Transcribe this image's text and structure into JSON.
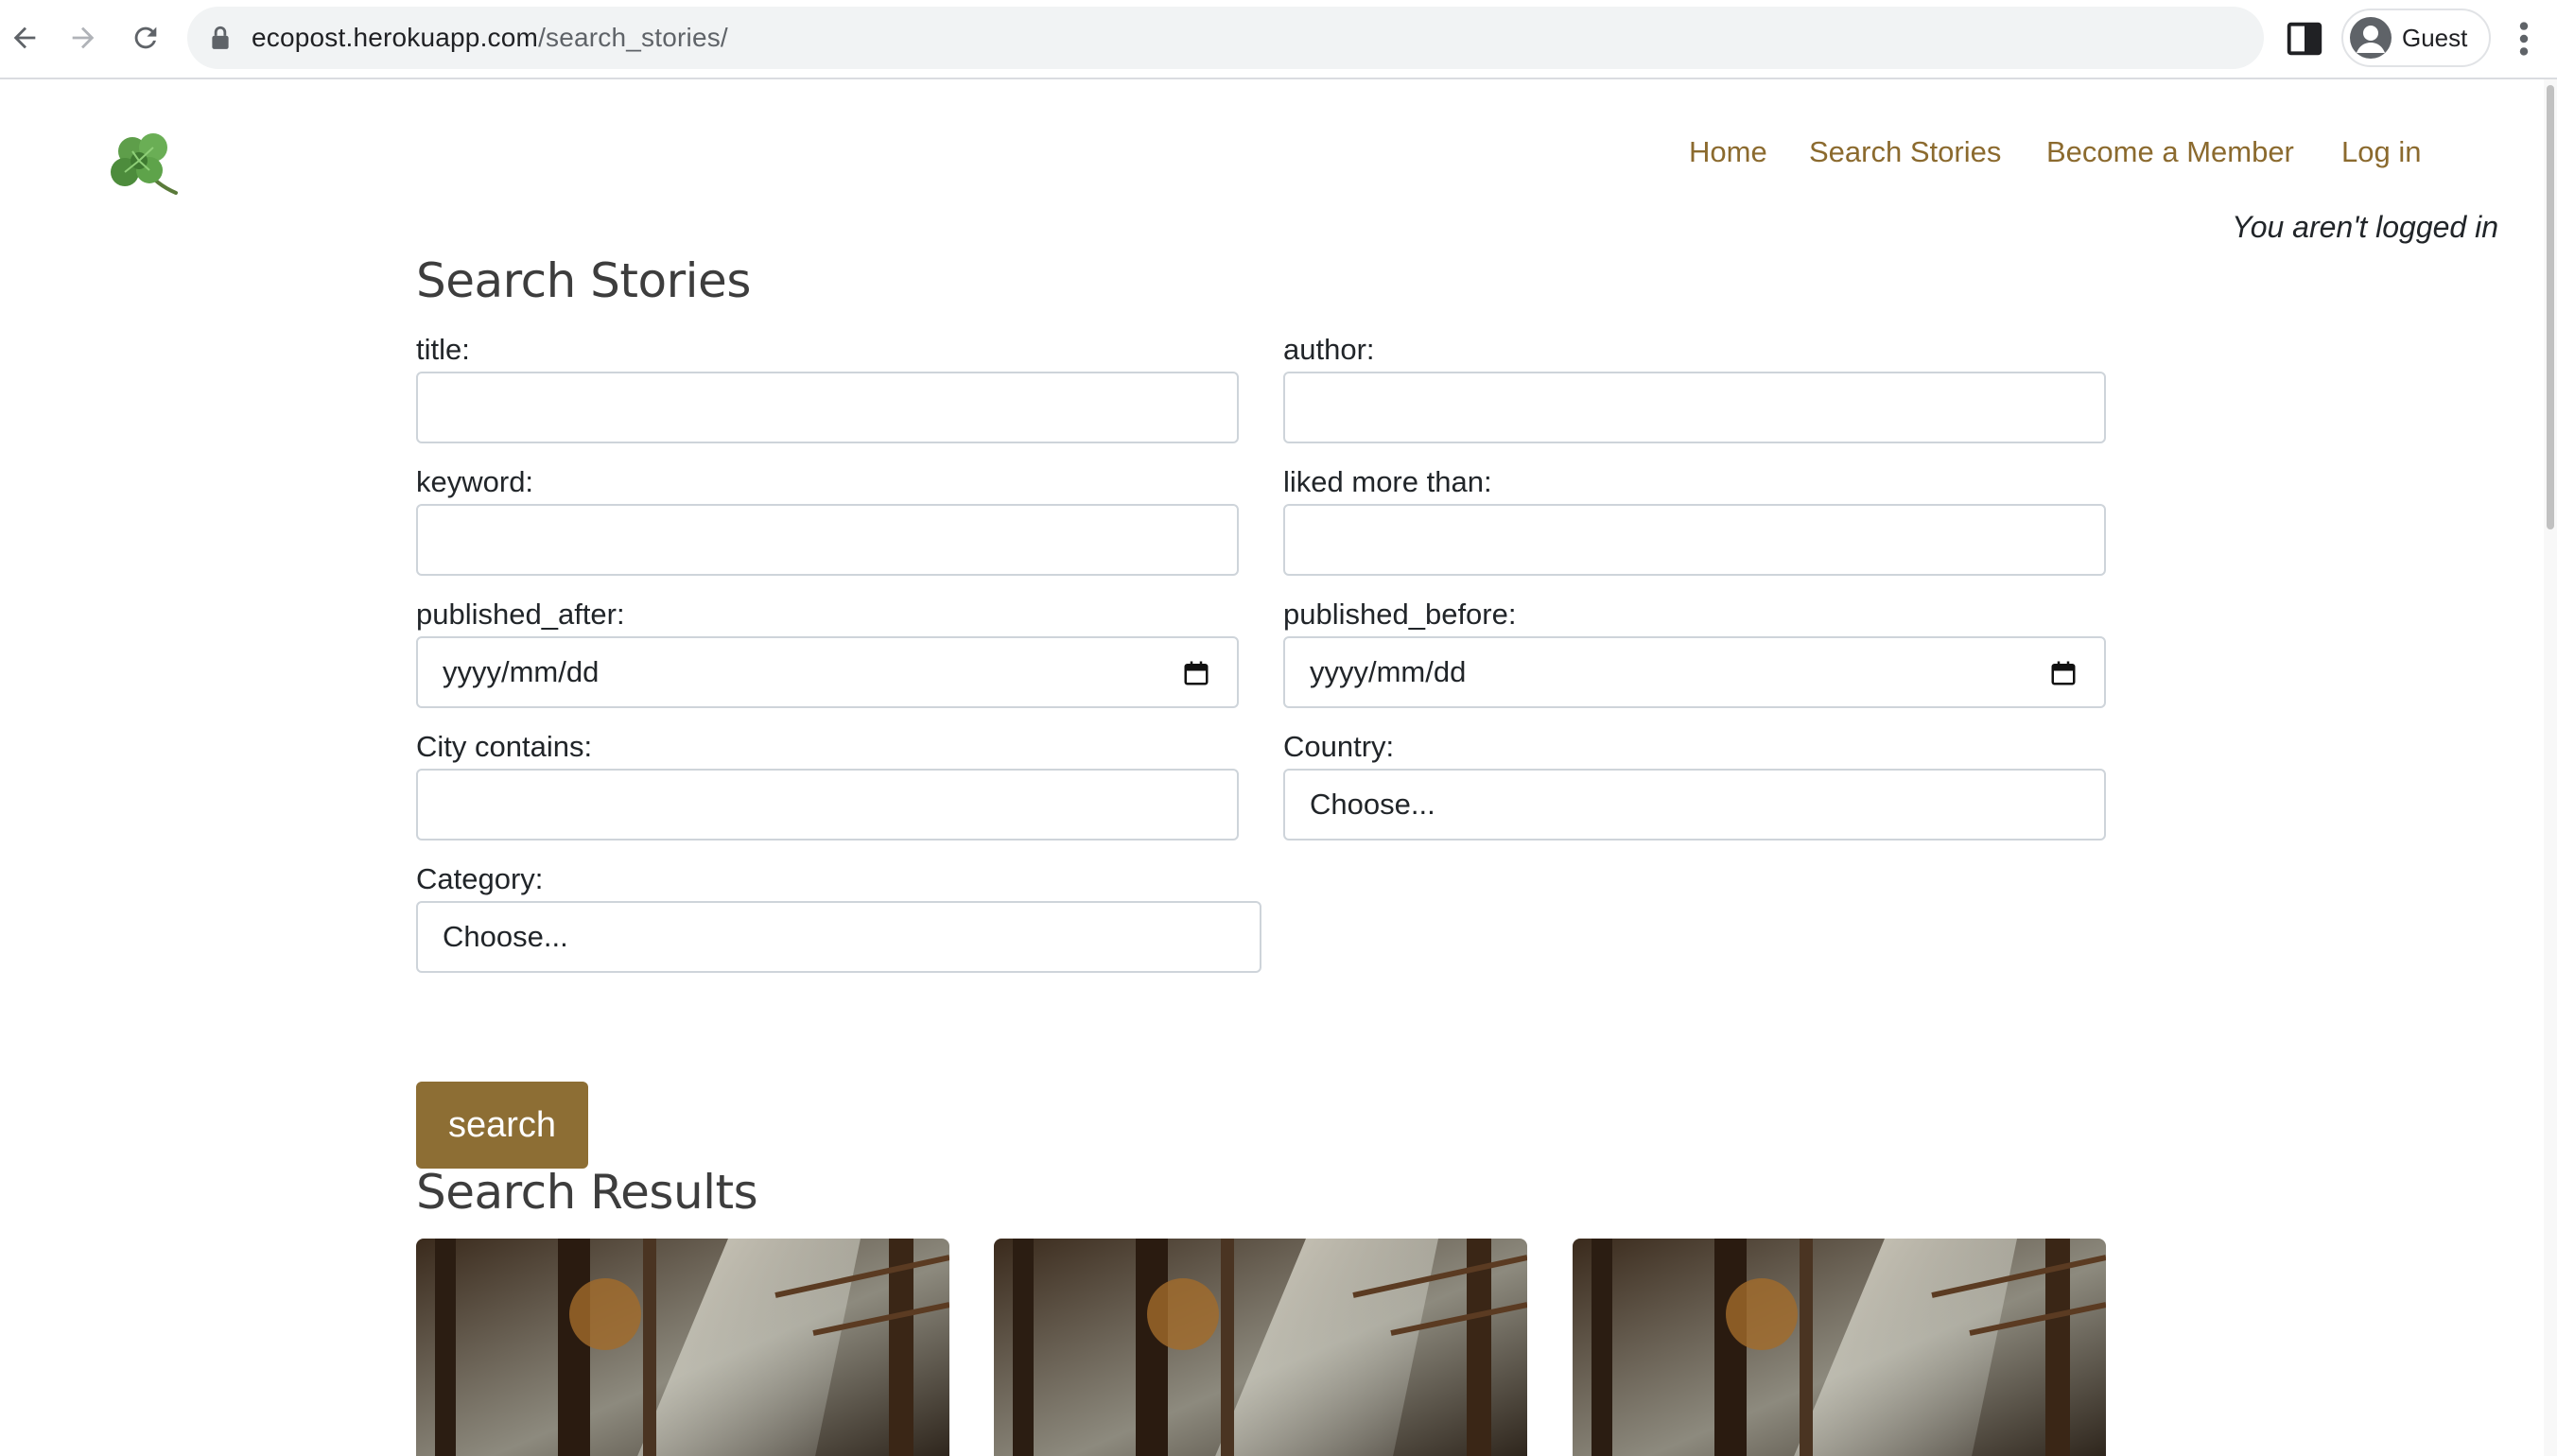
{
  "browser": {
    "url_host": "ecopost.herokuapp.com",
    "url_path": "/search_stories/",
    "profile_name": "Guest"
  },
  "nav": {
    "home": "Home",
    "search_stories": "Search Stories",
    "become_member": "Become a Member",
    "login": "Log in"
  },
  "status": {
    "login_text": "You aren't logged in"
  },
  "search_form": {
    "title": "Search Stories",
    "title_label": "title:",
    "author_label": "author:",
    "keyword_label": "keyword:",
    "liked_label": "liked more than:",
    "published_after_label": "published_after:",
    "published_after_value": "yyyy/mm/dd",
    "published_before_label": "published_before:",
    "published_before_value": "yyyy/mm/dd",
    "city_label": "City contains:",
    "country_label": "Country:",
    "country_value": "Choose...",
    "category_label": "Category:",
    "category_value": "Choose...",
    "submit_label": "search"
  },
  "results": {
    "title": "Search Results",
    "card_count": 3
  },
  "colors": {
    "accent": "#8d6e34",
    "nav_link": "#8b6a2e",
    "input_border": "#ced4da"
  },
  "icons": [
    "back-arrow-icon",
    "forward-arrow-icon",
    "reload-icon",
    "lock-icon",
    "side-panel-icon",
    "profile-icon",
    "menu-icon",
    "clover-logo",
    "calendar-icon"
  ]
}
